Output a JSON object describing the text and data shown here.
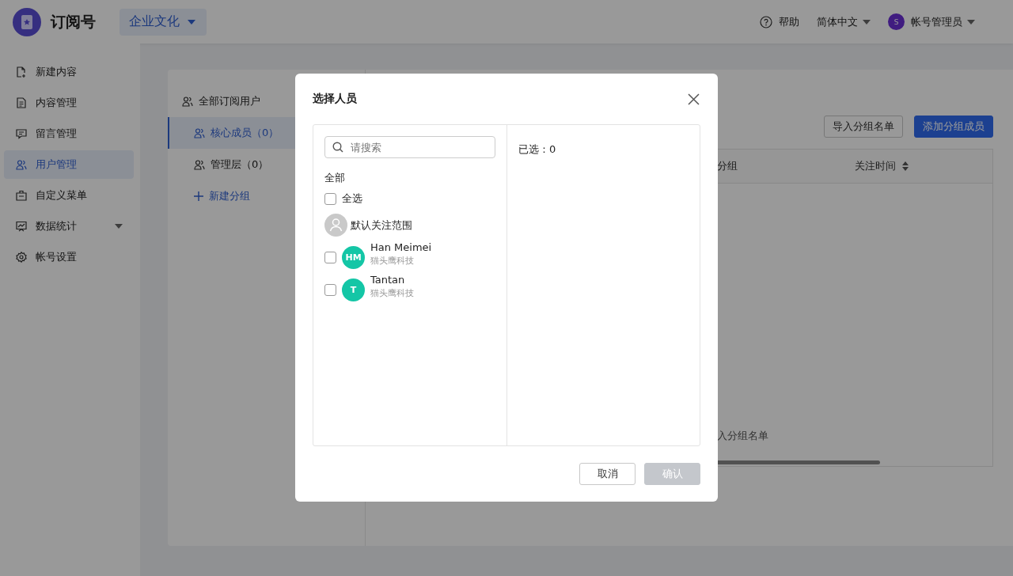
{
  "header": {
    "app_name": "订阅号",
    "account_switch": "企业文化",
    "help": "帮助",
    "language": "简体中文",
    "user": {
      "avatar": "S",
      "name": "帐号管理员"
    }
  },
  "sidebar": {
    "items": [
      {
        "label": "新建内容",
        "selected": false,
        "expandable": false
      },
      {
        "label": "内容管理",
        "selected": false,
        "expandable": false
      },
      {
        "label": "留言管理",
        "selected": false,
        "expandable": false
      },
      {
        "label": "用户管理",
        "selected": true,
        "expandable": false
      },
      {
        "label": "自定义菜单",
        "selected": false,
        "expandable": false
      },
      {
        "label": "数据统计",
        "selected": false,
        "expandable": true
      },
      {
        "label": "帐号设置",
        "selected": false,
        "expandable": false
      }
    ]
  },
  "groups": {
    "all": "全部订阅用户",
    "items": [
      {
        "label": "核心成员（0）",
        "selected": true
      },
      {
        "label": "管理层（0）",
        "selected": false
      }
    ],
    "add": "新建分组"
  },
  "toolbar": {
    "buttons": [
      {
        "label": "导入分组名单",
        "kind": "default"
      },
      {
        "label": "添加分组成员",
        "kind": "primary"
      }
    ]
  },
  "table": {
    "columns": [
      {
        "label": "分组",
        "sortable": false
      },
      {
        "label": "关注时间",
        "sortable": true
      }
    ],
    "empty_text": "入分组名单"
  },
  "dialog": {
    "title": "选择人员",
    "search": {
      "placeholder": "请搜索"
    },
    "section": "全部",
    "select_all": {
      "label": "全选",
      "checked": false
    },
    "scope": "默认关注范围",
    "people": [
      {
        "initials": "HM",
        "name": "Han Meimei",
        "org": "猫头鹰科技",
        "checked": false
      },
      {
        "initials": "T",
        "name": "Tantan",
        "org": "猫头鹰科技",
        "checked": false
      }
    ],
    "selected_count": "已选：0",
    "buttons": [
      {
        "label": "取消",
        "kind": "default",
        "disabled": false
      },
      {
        "label": "确认",
        "kind": "primary",
        "disabled": true
      }
    ]
  }
}
